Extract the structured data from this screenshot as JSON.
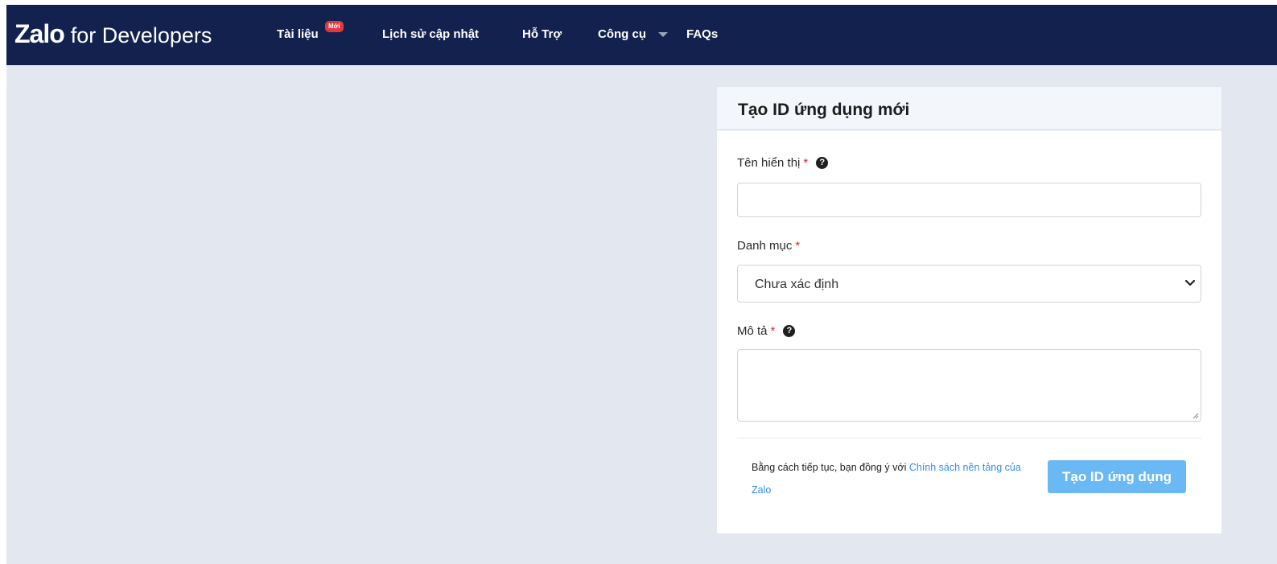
{
  "navbar": {
    "brand_logo": "Zalo",
    "brand_sub": "for Developers",
    "items": [
      {
        "label": "Tài liệu",
        "badge": "Mới"
      },
      {
        "label": "Lịch sử cập nhật"
      },
      {
        "label": "Hỗ Trợ"
      },
      {
        "label": "Công cụ"
      },
      {
        "label": "FAQs"
      }
    ],
    "badge_color": "#e0393e",
    "background": "#13214f"
  },
  "form": {
    "title": "Tạo ID ứng dụng mới",
    "display_name": {
      "label": "Tên hiển thị",
      "required_mark": "*",
      "value": "",
      "placeholder": ""
    },
    "category": {
      "label": "Danh mục",
      "required_mark": "*",
      "selected": "Chưa xác định"
    },
    "description": {
      "label": "Mô tả",
      "required_mark": "*",
      "value": "",
      "placeholder": ""
    },
    "consent_prefix": "Bằng cách tiếp tục, bạn đồng ý với",
    "policy_link": "Chính sách nền tảng của Zalo",
    "submit_label": "Tạo ID ứng dụng"
  },
  "icons": [
    "help-icon",
    "caret-down-icon",
    "chevron-down-icon",
    "resize-handle-icon"
  ],
  "colors": {
    "page_background": "#e3e7ef",
    "link": "#2f8ff0",
    "required": "#e0252b",
    "button": "#6ab9f4"
  }
}
